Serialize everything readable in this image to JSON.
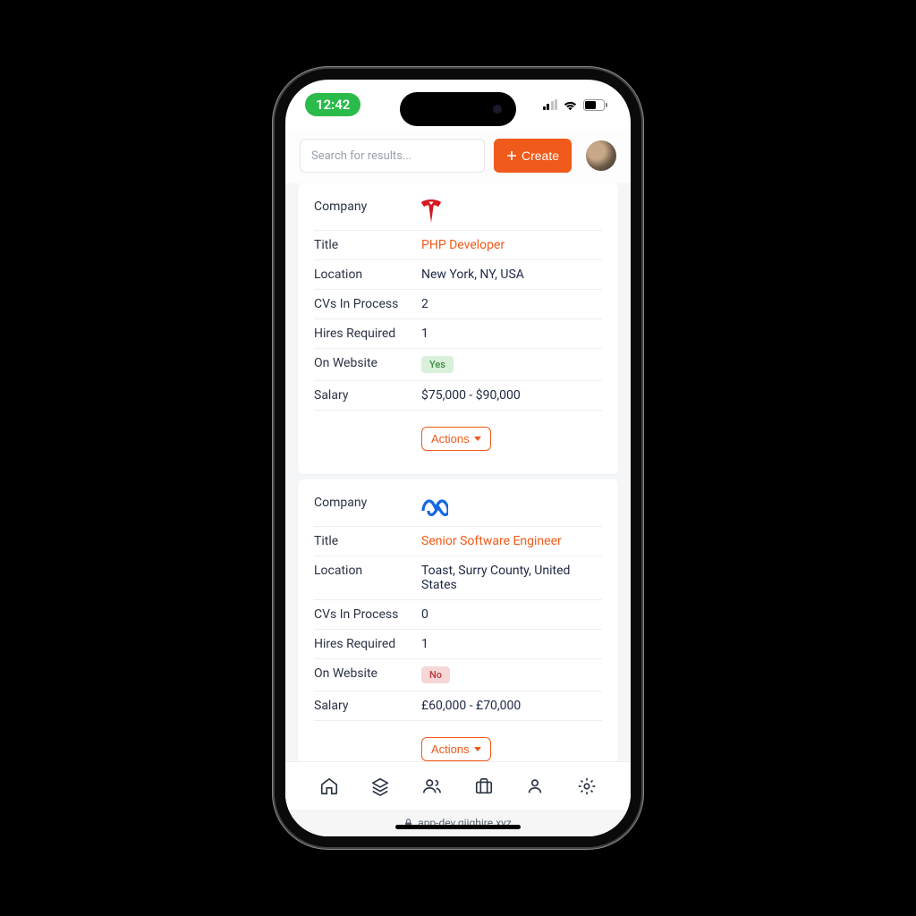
{
  "status": {
    "time": "12:42"
  },
  "topbar": {
    "search_placeholder": "Search for results...",
    "create_label": "Create"
  },
  "fields": {
    "company": "Company",
    "title": "Title",
    "location": "Location",
    "cvs": "CVs In Process",
    "hires": "Hires Required",
    "onweb": "On Website",
    "salary": "Salary",
    "actions": "Actions"
  },
  "badges": {
    "yes": "Yes",
    "no": "No"
  },
  "jobs": [
    {
      "company_icon": "tesla",
      "title": "PHP Developer",
      "location": "New York, NY, USA",
      "cvs": "2",
      "hires": "1",
      "onweb": "yes",
      "salary": "$75,000 - $90,000"
    },
    {
      "company_icon": "meta",
      "title": "Senior Software Engineer",
      "location": "Toast, Surry County, United States",
      "cvs": "0",
      "hires": "1",
      "onweb": "no",
      "salary": "£60,000 - £70,000"
    }
  ],
  "url": "app-dev.giighire.xyz"
}
